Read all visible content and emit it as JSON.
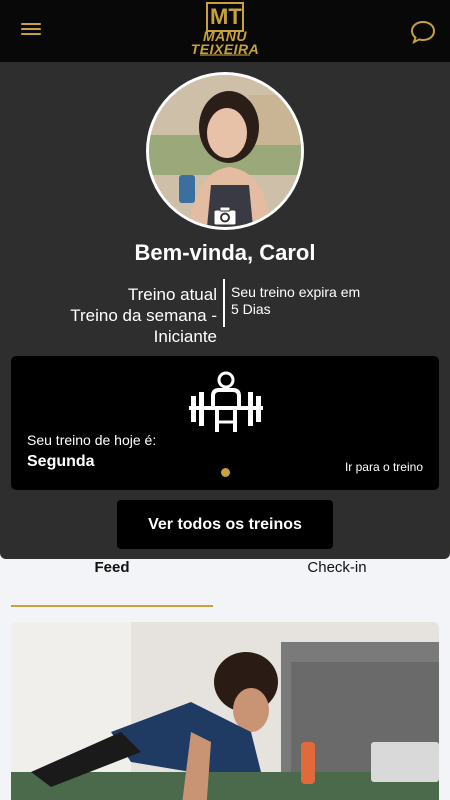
{
  "header": {
    "logo_monogram": "MT",
    "logo_line1": "MANU",
    "logo_line2": "TEIXEIRA"
  },
  "profile": {
    "greeting": "Bem-vinda, Carol",
    "plan_label_1": "Treino atual",
    "plan_label_2": "Treino da semana -",
    "plan_label_3": "Iniciante",
    "expiry_text_1": "Seu treino expira em",
    "expiry_text_2": "5 Dias"
  },
  "today_card": {
    "label": "Seu treino de hoje é:",
    "day": "Segunda",
    "link": "Ir para o treino"
  },
  "actions": {
    "all_workouts": "Ver todos os treinos"
  },
  "tabs": [
    {
      "label": "Feed",
      "active": true
    },
    {
      "label": "Check-in",
      "active": false
    }
  ],
  "colors": {
    "accent": "#c9a13a",
    "header_bg": "#080808",
    "profile_bg": "#2e2e2e"
  },
  "icons": {
    "menu": "hamburger-menu-icon",
    "chat": "chat-bubble-icon",
    "camera": "camera-icon",
    "workout": "weightlifter-icon"
  }
}
